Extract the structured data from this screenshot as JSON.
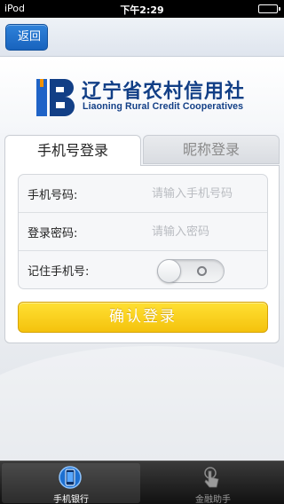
{
  "status_bar": {
    "device": "iPod",
    "time": "下午2:29",
    "battery_level": 1.0
  },
  "nav": {
    "back_label": "返回"
  },
  "logo": {
    "name_cn": "辽宁省农村信用社",
    "name_en": "Liaoning Rural Credit Cooperatives"
  },
  "login": {
    "tabs": [
      {
        "label": "手机号登录",
        "active": true
      },
      {
        "label": "昵称登录",
        "active": false
      }
    ],
    "phone_label": "手机号码:",
    "phone_placeholder": "请输入手机号码",
    "phone_value": "",
    "password_label": "登录密码:",
    "password_placeholder": "请输入密码",
    "password_value": "",
    "remember_label": "记住手机号:",
    "remember_on": false,
    "confirm_label": "确认登录"
  },
  "tab_bar": {
    "items": [
      {
        "label": "手机银行",
        "selected": true,
        "icon": "phone-icon"
      },
      {
        "label": "金融助手",
        "selected": false,
        "icon": "hand-pointer-icon"
      }
    ]
  },
  "colors": {
    "logo_blue": "#123f86",
    "nav_button_blue": "#1f6fcc",
    "confirm_yellow": "#f8cf14"
  }
}
